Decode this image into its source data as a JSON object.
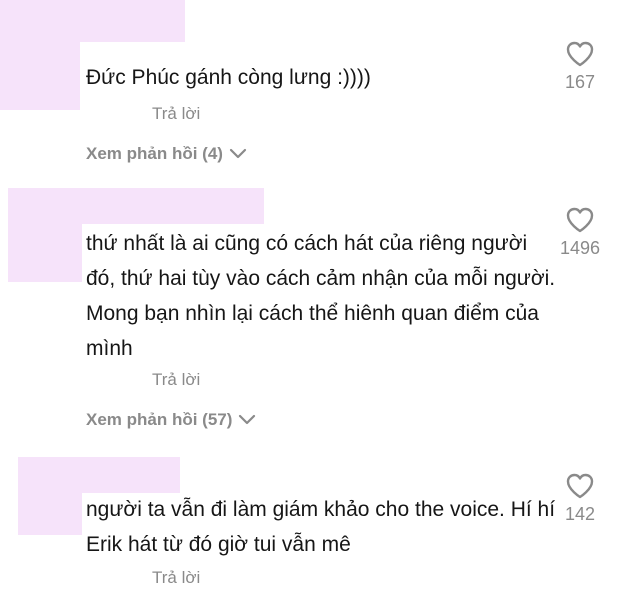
{
  "comments": [
    {
      "text": "Đức Phúc gánh còng lưng :))))",
      "reply_label": "Trả lời",
      "view_replies": "Xem phản hồi (4)",
      "likes": "167",
      "like_icon": "heart-outline-icon"
    },
    {
      "text": "thứ nhất là ai cũng có cách hát của riêng người đó, thứ hai tùy vào cách cảm nhận của mỗi người. Mong bạn nhìn lại cách thể hiênh quan điểm của mình",
      "reply_label": "Trả lời",
      "view_replies": "Xem phản hồi (57)",
      "likes": "1496",
      "like_icon": "heart-outline-icon"
    },
    {
      "text": "người ta vẫn đi làm giám khảo cho the voice. Hí hí Erik hát từ đó giờ tui vẫn mê",
      "reply_label": "Trả lời",
      "likes": "142",
      "like_icon": "heart-outline-icon"
    }
  ],
  "colors": {
    "redaction": "#f6e3fa",
    "text": "#161616",
    "muted": "#8a8a8a"
  }
}
